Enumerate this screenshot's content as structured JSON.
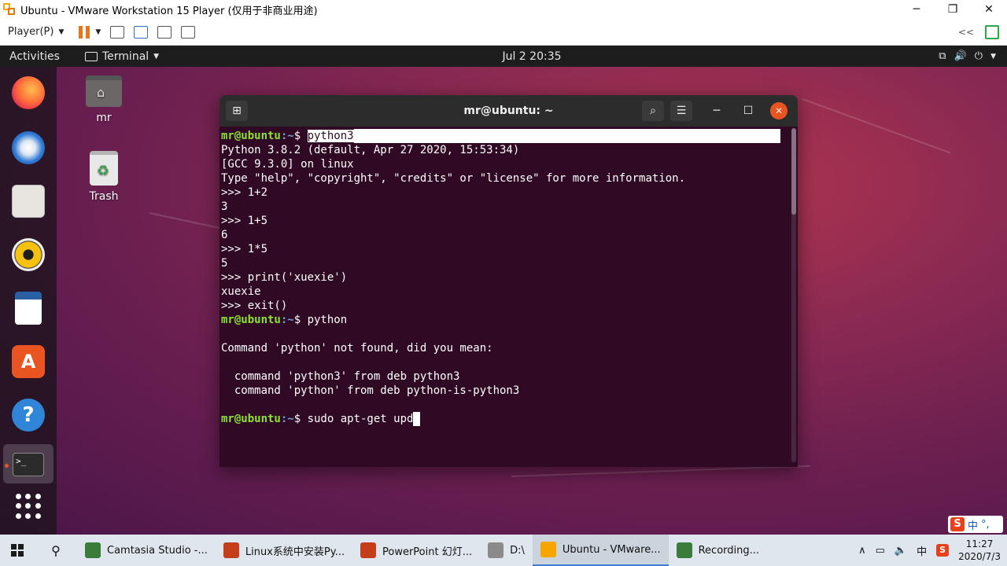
{
  "vm": {
    "title": "Ubuntu - VMware Workstation 15 Player (仅用于非商业用途)",
    "minimize": "─",
    "maximize": "❐",
    "close": "✕",
    "player_menu": "Player(P)",
    "collapse": "<<"
  },
  "ubuntu_topbar": {
    "activities": "Activities",
    "app_menu": "Terminal",
    "clock": "Jul 2  20:35"
  },
  "desktop": {
    "icons": [
      {
        "label": "mr"
      },
      {
        "label": "Trash"
      }
    ]
  },
  "dock": {
    "items": [
      "firefox-icon",
      "thunderbird-icon",
      "files-icon",
      "rhythmbox-icon",
      "libreoffice-writer-icon",
      "ubuntu-software-icon",
      "help-icon",
      "terminal-icon",
      "show-applications-icon"
    ],
    "terminal_glyph": ">_"
  },
  "terminal": {
    "title": "mr@ubuntu: ~",
    "prompt_user": "mr@ubuntu",
    "prompt_sep": ":~",
    "prompt_dollar": "$ ",
    "lines": [
      {
        "kind": "prompt",
        "cmd": "python3",
        "selected": true
      },
      {
        "kind": "out",
        "text": "Python 3.8.2 (default, Apr 27 2020, 15:53:34)"
      },
      {
        "kind": "out",
        "text": "[GCC 9.3.0] on linux"
      },
      {
        "kind": "out",
        "text": "Type \"help\", \"copyright\", \"credits\" or \"license\" for more information."
      },
      {
        "kind": "out",
        "text": ">>> 1+2"
      },
      {
        "kind": "out",
        "text": "3"
      },
      {
        "kind": "out",
        "text": ">>> 1+5"
      },
      {
        "kind": "out",
        "text": "6"
      },
      {
        "kind": "out",
        "text": ">>> 1*5"
      },
      {
        "kind": "out",
        "text": "5"
      },
      {
        "kind": "out",
        "text": ">>> print('xuexie')"
      },
      {
        "kind": "out",
        "text": "xuexie"
      },
      {
        "kind": "out",
        "text": ">>> exit()"
      },
      {
        "kind": "prompt",
        "cmd": "python"
      },
      {
        "kind": "out",
        "text": ""
      },
      {
        "kind": "out",
        "text": "Command 'python' not found, did you mean:"
      },
      {
        "kind": "out",
        "text": ""
      },
      {
        "kind": "out",
        "text": "  command 'python3' from deb python3"
      },
      {
        "kind": "out",
        "text": "  command 'python' from deb python-is-python3"
      },
      {
        "kind": "out",
        "text": ""
      },
      {
        "kind": "prompt",
        "cmd": "sudo apt-get upd",
        "cursor": true
      }
    ]
  },
  "taskbar": {
    "tasks": [
      {
        "label": "Camtasia Studio -...",
        "icon": "camtasia-icon",
        "color": "#3a7d3a"
      },
      {
        "label": "Linux系统中安装Py...",
        "icon": "powerpoint-icon",
        "color": "#c43e1c"
      },
      {
        "label": "PowerPoint 幻灯...",
        "icon": "powerpoint-icon",
        "color": "#c43e1c"
      },
      {
        "label": "D:\\",
        "icon": "drive-icon",
        "color": "#8a8a8a"
      },
      {
        "label": "Ubuntu - VMware...",
        "icon": "vmware-icon",
        "color": "#f7a600",
        "active": true
      },
      {
        "label": "Recording...",
        "icon": "recording-icon",
        "color": "#3a7d3a"
      }
    ],
    "ime": "中",
    "time": "11:27",
    "date": "2020/7/3"
  },
  "ime_float": {
    "lang": "中",
    "extra": "°,"
  }
}
